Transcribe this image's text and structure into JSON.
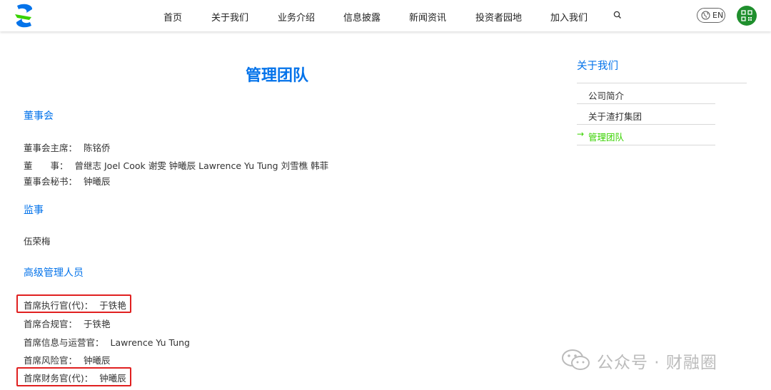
{
  "header": {
    "nav": [
      "首页",
      "关于我们",
      "业务介绍",
      "信息披露",
      "新闻资讯",
      "投资者园地",
      "加入我们"
    ],
    "lang": "EN",
    "icons": {
      "logo": "standard-chartered-logo",
      "search": "search-icon",
      "lang": "globe-icon",
      "qr": "qr-code-icon"
    },
    "colors": {
      "brand_blue": "#0473ea",
      "brand_green": "#38d200",
      "qr_green": "#1f8f2d"
    }
  },
  "main": {
    "title": "管理团队",
    "sections": [
      {
        "title": "董事会"
      },
      {
        "title": "监事"
      },
      {
        "title": "高级管理人员"
      }
    ],
    "board": [
      {
        "label": "董事会主席：",
        "value": "陈铭侨"
      },
      {
        "label": "董　　事：",
        "value": "曾继志 Joel Cook 谢雯 钟曦辰 Lawrence Yu Tung 刘雪樵 韩菲"
      },
      {
        "label": "董事会秘书：",
        "value": "钟曦辰"
      }
    ],
    "supervisor": "伍荣梅",
    "executives": [
      {
        "label": "首席执行官(代)：",
        "value": "于铁艳"
      },
      {
        "label": "首席合规官：",
        "value": "于铁艳"
      },
      {
        "label": "首席信息与运营官：",
        "value": "Lawrence Yu Tung"
      },
      {
        "label": "首席风险官：",
        "value": "钟曦辰"
      },
      {
        "label": "首席财务官(代)：",
        "value": "钟曦辰"
      }
    ]
  },
  "sidebar": {
    "title": "关于我们",
    "items": [
      {
        "label": "公司简介",
        "active": false
      },
      {
        "label": "关于渣打集团",
        "active": false
      },
      {
        "label": "管理团队",
        "active": true
      }
    ]
  },
  "watermark": {
    "text": "公众号 · 财融圈",
    "icon": "wechat-icon"
  }
}
